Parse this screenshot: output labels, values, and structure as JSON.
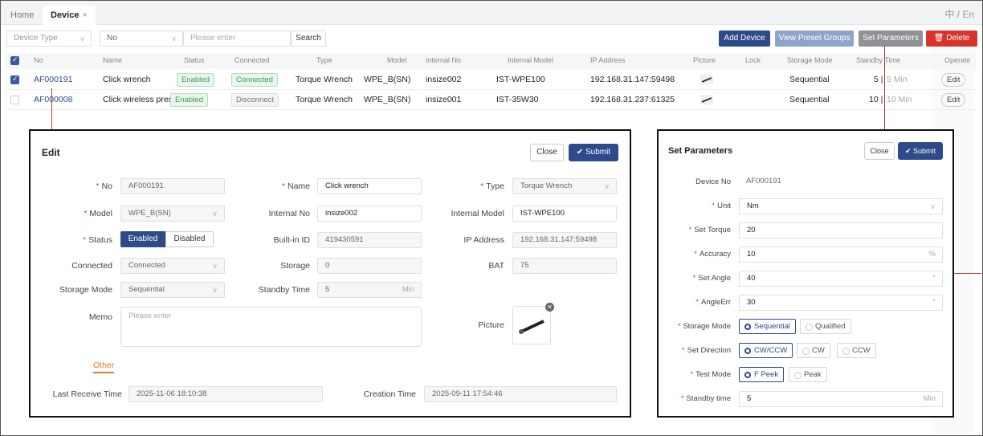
{
  "tabs": [
    {
      "label": "Home"
    },
    {
      "label": "Device",
      "close": "×"
    }
  ],
  "lang": "中 / En",
  "filters": {
    "device_type": "Device Type",
    "no": "No",
    "search_placeholder": "Please enter",
    "search_button": "Search"
  },
  "toolbar": {
    "add": "Add Device",
    "view_preset": "View Preset Groups",
    "set_params": "Set Parameters",
    "delete": "Delete"
  },
  "table": {
    "headers": [
      "No",
      "Name",
      "Status",
      "Connected",
      "Type",
      "Model",
      "Internal No",
      "Internal Model",
      "IP Address",
      "Picture",
      "Lock",
      "Storage Mode",
      "Standby Time",
      "Operate"
    ],
    "rows": [
      {
        "no": "AF000191",
        "name": "Click wrench",
        "status": "Enabled",
        "connected": "Connected",
        "type": "Torque Wrench",
        "model": "WPE_B(SN)",
        "internal_no": "insize002",
        "internal_model": "IST-WPE100",
        "ip": "192.168.31.147:59498",
        "storage": "Sequential",
        "standby_a": "5 |",
        "standby_b": "5 Min",
        "operate": "Edit",
        "checked": true
      },
      {
        "no": "AF000008",
        "name": "Click wireless preset..",
        "status": "Enabled",
        "connected": "Disconnect",
        "type": "Torque Wrench",
        "model": "WPE_B(SN)",
        "internal_no": "insize001",
        "internal_model": "IST-35W30",
        "ip": "192.168.31.237:61325",
        "storage": "Sequential",
        "standby_a": "10 |",
        "standby_b": "10 Min",
        "operate": "Edit",
        "checked": false
      }
    ]
  },
  "edit": {
    "title": "Edit",
    "close": "Close",
    "submit": "Submit",
    "no_label": "No",
    "no": "AF000191",
    "name_label": "Name",
    "name": "Click wrench",
    "type_label": "Type",
    "type": "Torque Wrench",
    "model_label": "Model",
    "model": "WPE_B(SN)",
    "internal_no_label": "Internal No",
    "internal_no": "insize002",
    "internal_model_label": "Internal Model",
    "internal_model": "IST-WPE100",
    "status_label": "Status",
    "enabled": "Enabled",
    "disabled": "Disabled",
    "builtin_label": "Built-in ID",
    "builtin": "419430591",
    "ip_label": "IP Address",
    "ip": "192.168.31.147:59498",
    "connected_label": "Connected",
    "connected": "Connected",
    "storage_label": "Storage",
    "storage": "0",
    "bat_label": "BAT",
    "bat": "75",
    "storage_mode_label": "Storage Mode",
    "storage_mode": "Sequential",
    "standby_label": "Standby Time",
    "standby": "5",
    "standby_unit": "Min",
    "memo_label": "Memo",
    "memo_placeholder": "Please enter",
    "picture_label": "Picture",
    "other": "Other",
    "last_receive_label": "Last Receive Time",
    "last_receive": "2025-11-06 18:10:38",
    "creation_label": "Creation Time",
    "creation": "2025-09-11 17:54:46"
  },
  "params": {
    "title": "Set Parameters",
    "close": "Close",
    "submit": "Submit",
    "device_no_label": "Device No",
    "device_no": "AF000191",
    "unit_label": "Unit",
    "unit": "Nm",
    "torque_label": "Set Torque",
    "torque": "20",
    "accuracy_label": "Accuracy",
    "accuracy": "10",
    "accuracy_unit": "%",
    "angle_label": "Set Angle",
    "angle": "40",
    "angle_err_label": "AngleErr",
    "angle_err": "30",
    "storage_mode_label": "Storage Mode",
    "sm_opts": [
      "Sequential",
      "Qualified"
    ],
    "direction_label": "Set Direction",
    "dir_opts": [
      "CW/CCW",
      "CW",
      "CCW"
    ],
    "test_mode_label": "Test Mode",
    "tm_opts": [
      "F Peek",
      "Peak"
    ],
    "standby_label": "Standby time",
    "standby": "5",
    "standby_unit": "Min"
  }
}
